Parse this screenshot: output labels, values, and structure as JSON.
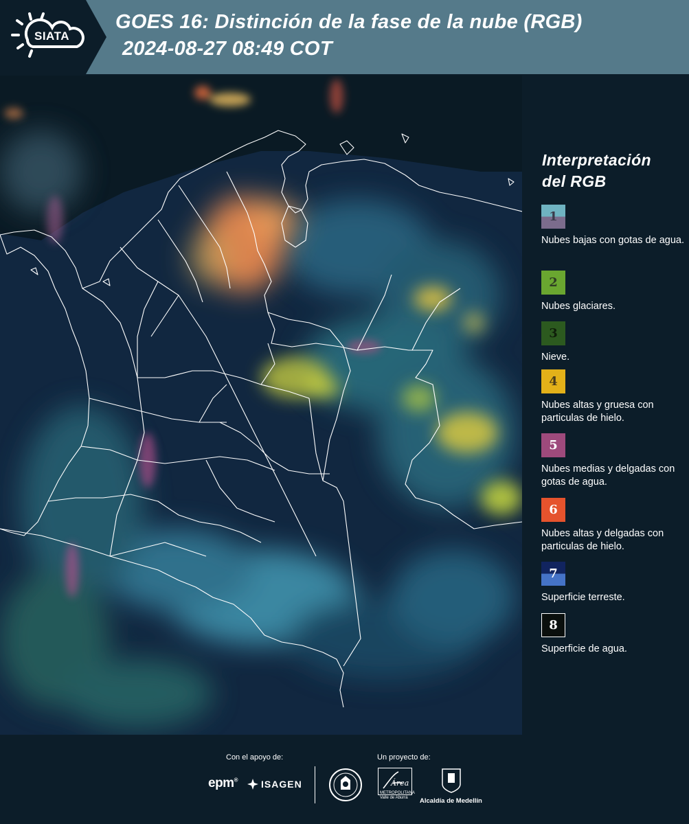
{
  "header": {
    "logo_text": "SIATA",
    "title_line1": "GOES 16: Distinción de la fase de la nube (RGB)",
    "title_line2": "2024-08-27 08:49 COT"
  },
  "legend": {
    "title_line1": "Interpretación",
    "title_line2": "del RGB",
    "items": [
      {
        "number": "1",
        "label": "Nubes bajas con gotas de agua.",
        "color_top": "#6fb3c1",
        "color_bottom": "#7b6c8c",
        "number_color": "#3b3b4b"
      },
      {
        "number": "2",
        "label": "Nubes glaciares.",
        "color_top": "#6aa630",
        "color_bottom": "#6aa630",
        "number_color": "#2f3d24"
      },
      {
        "number": "3",
        "label": "Nieve.",
        "color_top": "#2c5a1f",
        "color_bottom": "#2c5a1f",
        "number_color": "#0f1e0a"
      },
      {
        "number": "4",
        "label": "Nubes altas y gruesa con particulas de hielo.",
        "color_top": "#e3b119",
        "color_bottom": "#e3b119",
        "number_color": "#4a3c1a"
      },
      {
        "number": "5",
        "label": "Nubes medias y delgadas con gotas de agua.",
        "color_top": "#9e4a7c",
        "color_bottom": "#9e4a7c",
        "number_color": "#ffffff"
      },
      {
        "number": "6",
        "label": "Nubes altas y delgadas con particulas de hielo.",
        "color_top": "#e5532d",
        "color_bottom": "#e5532d",
        "number_color": "#ffffff"
      },
      {
        "number": "7",
        "label": "Superficie terreste.",
        "color_top": "#11245f",
        "color_bottom": "#4573c7",
        "number_color": "#ffffff"
      },
      {
        "number": "8",
        "label": "Superficie de agua.",
        "color_top": "#0a0f0d",
        "color_bottom": "#0a0f0d",
        "number_color": "#ffffff"
      }
    ]
  },
  "footer": {
    "support_label": "Con el apoyo de:",
    "project_label": "Un proyecto de:",
    "sponsor1": "epm",
    "sponsor2": "ISAGEN",
    "partner_area": "Área",
    "partner_area_sub1": "METROPOLITANA",
    "partner_area_sub2": "Valle de Aburrá",
    "partner_alcaldia": "Alcaldía de Medellín"
  }
}
